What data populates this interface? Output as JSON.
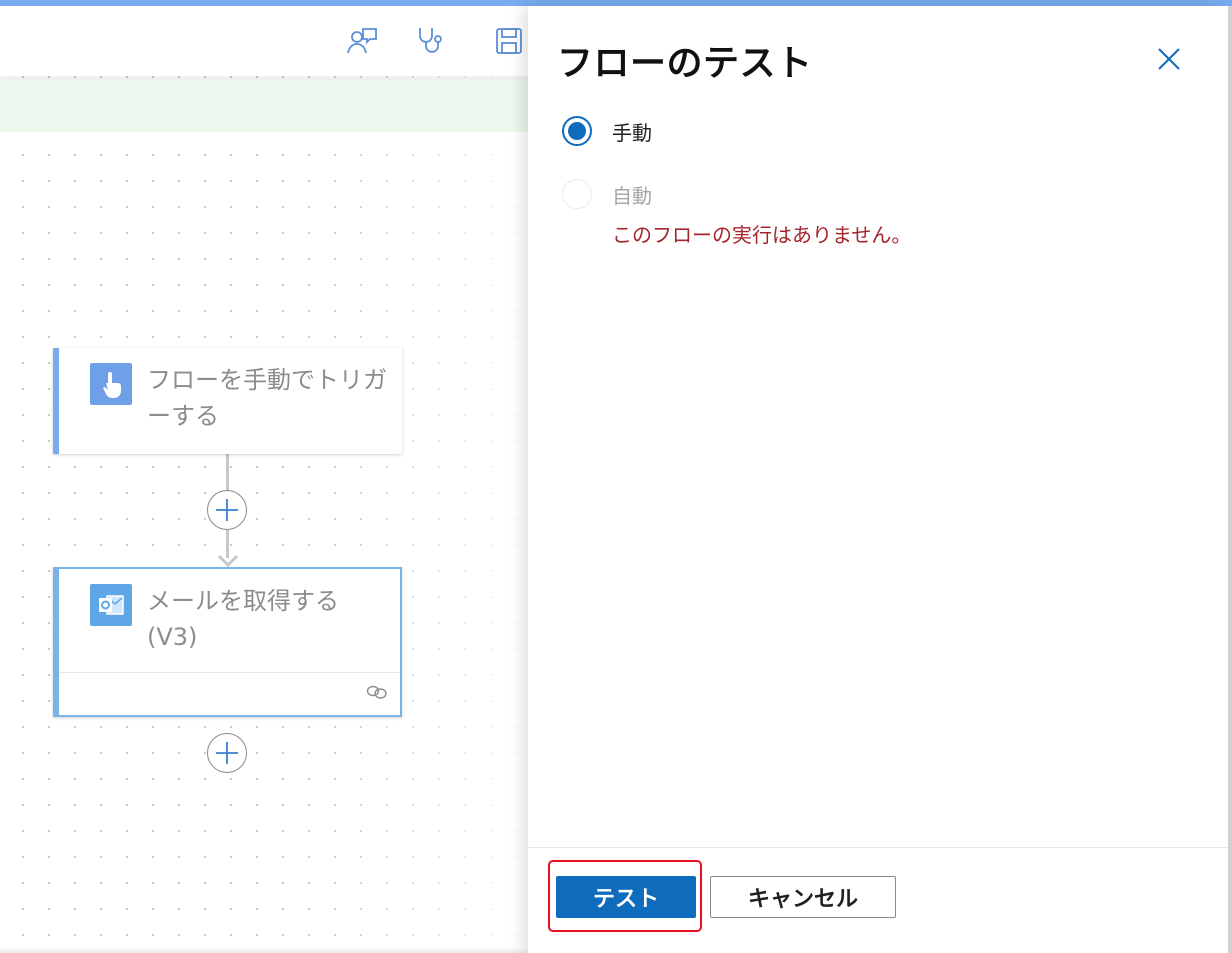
{
  "toolbar": {
    "icons": [
      "flow-checker-icon",
      "stethoscope-icon",
      "save-icon"
    ]
  },
  "flow": {
    "trigger": {
      "title": "フローを手動でトリガーする",
      "icon": "touch-hand-icon",
      "color": "#7aaaf0"
    },
    "action": {
      "title": "メールを取得する (V3)",
      "icon": "outlook-icon",
      "color": "#7ab4e6"
    }
  },
  "panel": {
    "title": "フローのテスト",
    "options": {
      "manual": {
        "label": "手動",
        "selected": true
      },
      "auto": {
        "label": "自動",
        "selected": false,
        "disabled": true
      }
    },
    "auto_warning": "このフローの実行はありません。",
    "buttons": {
      "test": "テスト",
      "cancel": "キャンセル"
    }
  },
  "colors": {
    "accent": "#0f6cbd",
    "error": "#a4262c",
    "highlight": "#e81123"
  }
}
